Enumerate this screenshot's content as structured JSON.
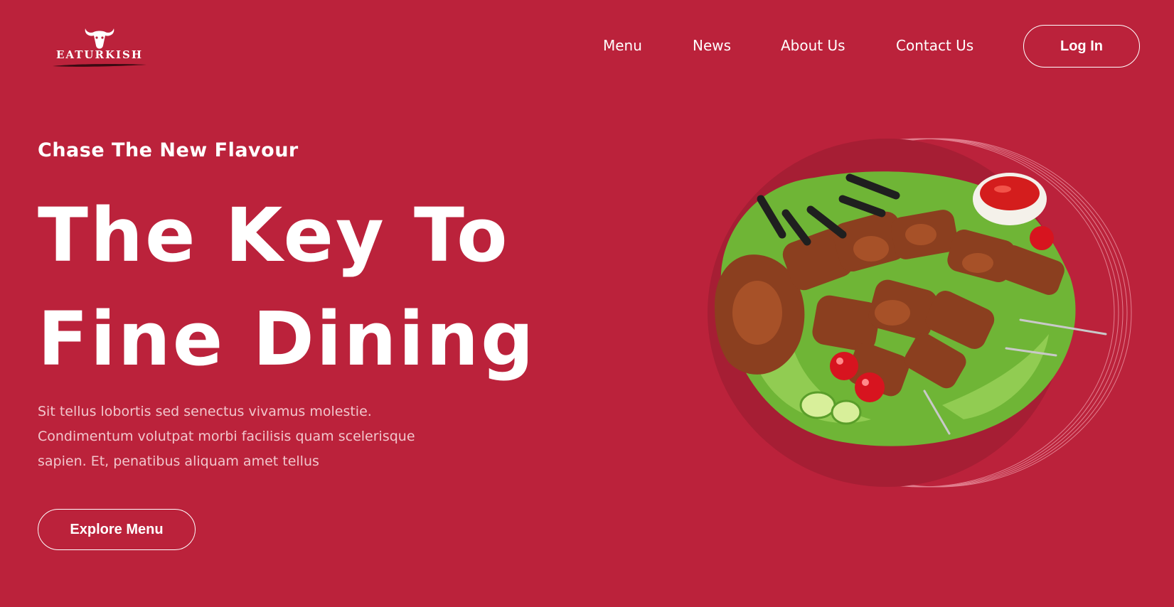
{
  "brand": {
    "logo_text": "EATURKISH"
  },
  "nav": {
    "items": [
      {
        "label": "Menu"
      },
      {
        "label": "News"
      },
      {
        "label": "About Us"
      },
      {
        "label": "Contact Us"
      }
    ],
    "login_label": "Log In"
  },
  "hero": {
    "tagline": "Chase The New Flavour",
    "headline_line1": "The Key To",
    "headline_line2": "Fine Dining",
    "description": "Sit tellus lobortis sed senectus vivamus molestie. Condimentum volutpat morbi facilisis quam scelerisque sapien. Et, penatibus aliquam amet tellus",
    "cta_label": "Explore Menu"
  },
  "colors": {
    "background": "#bb223b",
    "plate": "#a61e34",
    "text": "#ffffff",
    "muted_text": "#f1c6cc"
  }
}
